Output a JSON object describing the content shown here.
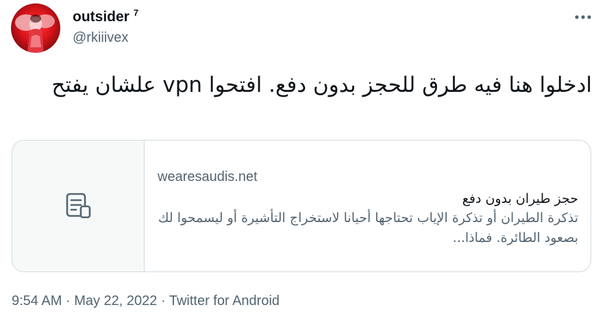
{
  "author": {
    "display_name": "outsider",
    "name_suffix": "7",
    "handle": "@rkiiivex"
  },
  "tweet": {
    "text": "ادخلوا هنا فيه طرق للحجز بدون دفع. افتحوا vpn علشان يفتح"
  },
  "card": {
    "domain": "wearesaudis.net",
    "title": "حجز طيران بدون دفع",
    "description": "تذكرة الطيران أو تذكرة الإياب تحتاجها أحيانا لاستخراج التأشيرة أو ليسمحوا لك بصعود الطائرة. فماذا...",
    "media_icon": "document-icon"
  },
  "meta": {
    "time": "9:54 AM",
    "separator": "·",
    "date": "May 22, 2022",
    "source": "Twitter for Android"
  },
  "icons": {
    "more": "more-horizontal-icon"
  },
  "colors": {
    "text_primary": "#0f1419",
    "text_secondary": "#536471",
    "border": "#cfd9de",
    "card_media_bg": "#f7f9f9"
  }
}
